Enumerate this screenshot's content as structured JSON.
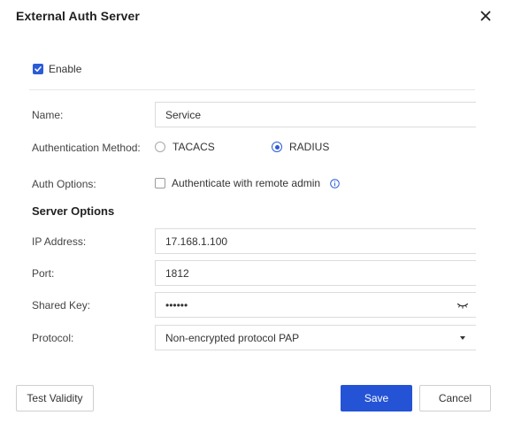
{
  "dialog": {
    "title": "External Auth Server"
  },
  "enable": {
    "label": "Enable",
    "checked": true
  },
  "form": {
    "name_label": "Name:",
    "name_value": "Service",
    "auth_method_label": "Authentication Method:",
    "auth_methods": [
      {
        "label": "TACACS",
        "selected": false
      },
      {
        "label": "RADIUS",
        "selected": true
      }
    ],
    "auth_options_label": "Auth Options:",
    "auth_option_text": "Authenticate with remote admin",
    "auth_option_checked": false
  },
  "server_options": {
    "heading": "Server Options",
    "ip_label": "IP Address:",
    "ip_value": "17.168.1.100",
    "port_label": "Port:",
    "port_value": "1812",
    "shared_key_label": "Shared Key:",
    "shared_key_value": "••••••",
    "protocol_label": "Protocol:",
    "protocol_value": "Non-encrypted protocol PAP"
  },
  "buttons": {
    "test_validity": "Test Validity",
    "save": "Save",
    "cancel": "Cancel"
  },
  "colors": {
    "accent": "#2453d6",
    "border": "#dcdcdc"
  },
  "icons": {
    "close": "close-icon",
    "checkbox": "checkbox-icon",
    "info": "info-icon",
    "eye": "eye-closed-icon",
    "dropdown": "caret-down-icon"
  }
}
